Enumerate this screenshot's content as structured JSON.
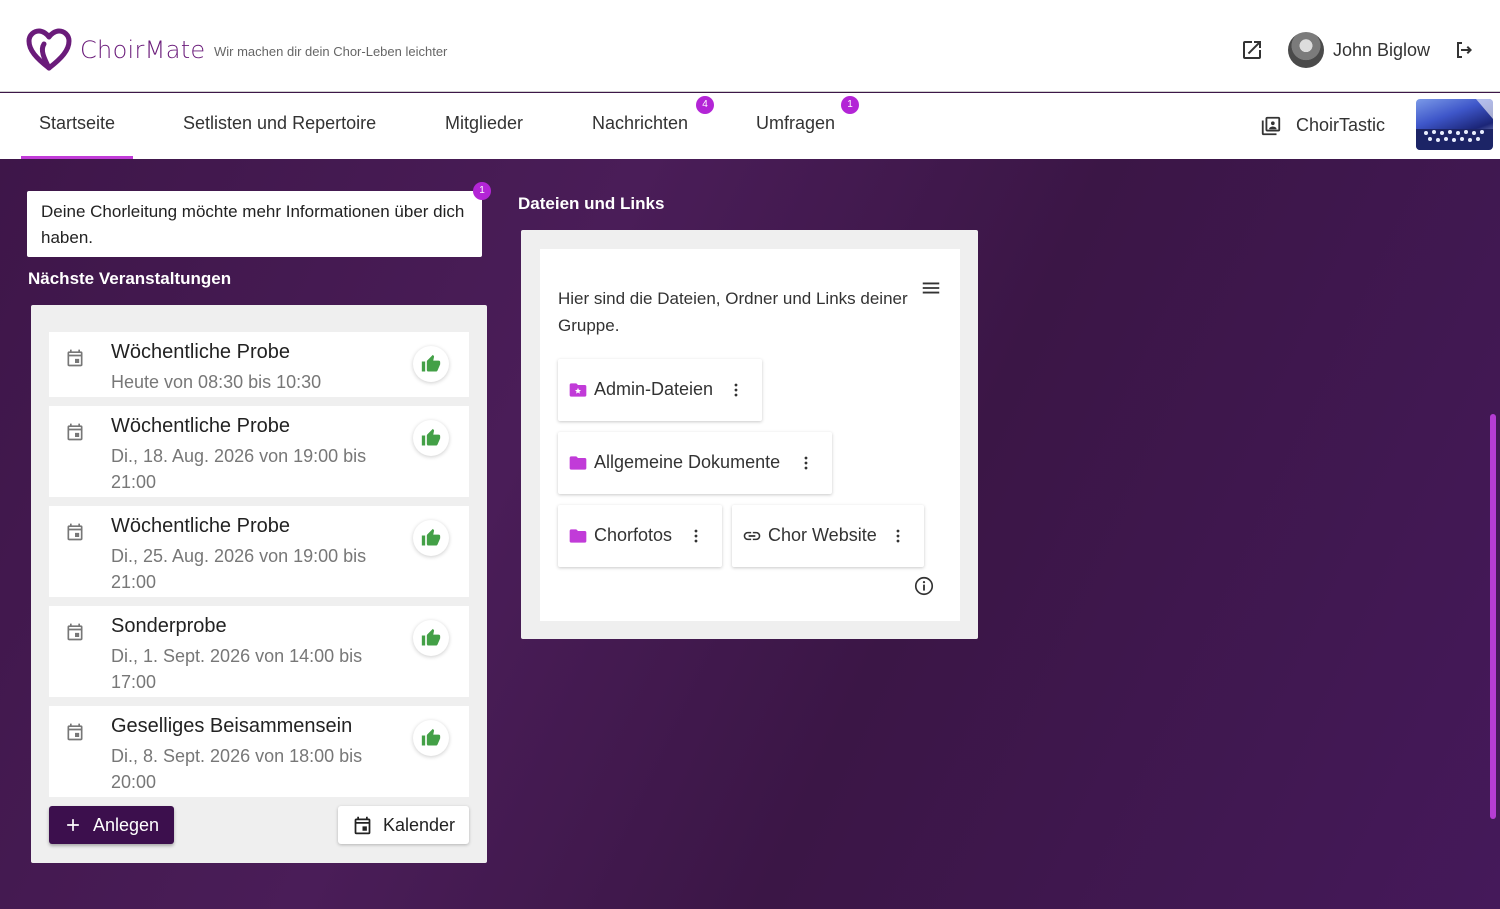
{
  "header": {
    "brand": "ChoirMate",
    "tagline": "Wir machen dir dein Chor-Leben leichter",
    "user_name": "John Biglow",
    "icons": [
      "heart-logo-icon",
      "open-external-icon",
      "logout-icon"
    ]
  },
  "nav": {
    "tabs": [
      {
        "label": "Startseite",
        "active": true
      },
      {
        "label": "Setlisten und Repertoire",
        "active": false
      },
      {
        "label": "Mitglieder",
        "active": false
      },
      {
        "label": "Nachrichten",
        "badge": "4"
      },
      {
        "label": "Umfragen",
        "badge": "1"
      }
    ],
    "choir_name": "ChoirTastic"
  },
  "notice": {
    "text": "Deine Chorleitung möchte mehr Informationen über dich haben.",
    "badge": "1"
  },
  "events": {
    "title": "Nächste Veranstaltungen",
    "items": [
      {
        "title": "Wöchentliche Probe",
        "date": "Heute von 08:30 bis 10:30"
      },
      {
        "title": "Wöchentliche Probe",
        "date": "Di., 18. Aug. 2026 von 19:00 bis 21:00"
      },
      {
        "title": "Wöchentliche Probe",
        "date": "Di., 25. Aug. 2026 von 19:00 bis 21:00"
      },
      {
        "title": "Sonderprobe",
        "date": "Di., 1. Sept. 2026 von 14:00 bis 17:00"
      },
      {
        "title": "Geselliges Beisammensein",
        "date": "Di., 8. Sept. 2026 von 18:00 bis 20:00"
      }
    ],
    "create_label": "Anlegen",
    "calendar_label": "Kalender"
  },
  "files": {
    "title": "Dateien und Links",
    "description": "Hier sind die Dateien, Ordner und Links deiner Gruppe.",
    "items": [
      {
        "label": "Admin-Dateien",
        "icon": "admin-folder-icon"
      },
      {
        "label": "Allgemeine Dokumente",
        "icon": "folder-icon"
      },
      {
        "label": "Chorfotos",
        "icon": "folder-icon"
      },
      {
        "label": "Chor Website",
        "icon": "link-icon"
      }
    ]
  },
  "colors": {
    "accent": "#c13bd8",
    "primary_dark": "#3c0f4d",
    "background": "#3d1748",
    "thumb_green": "#43a047"
  }
}
